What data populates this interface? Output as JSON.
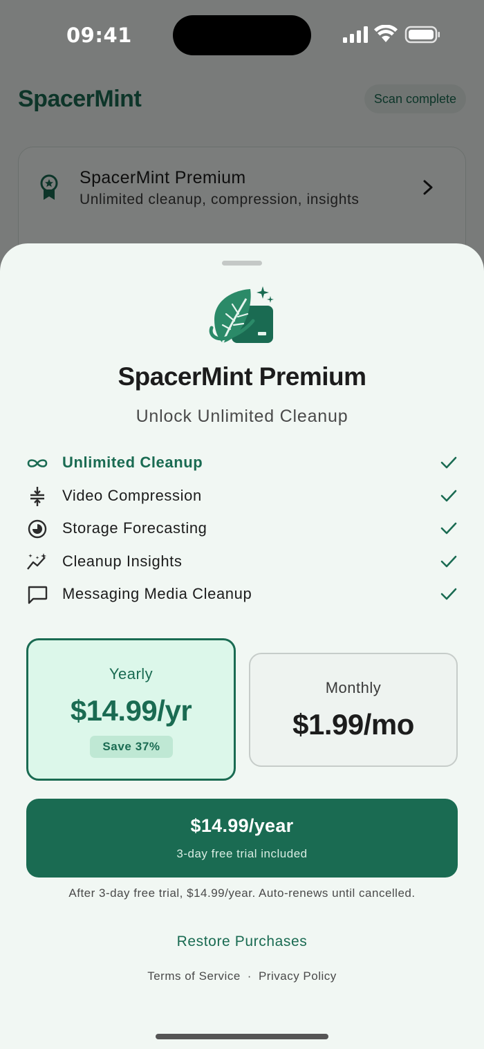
{
  "status_bar": {
    "time": "09:41"
  },
  "background": {
    "brand": "SpacerMint",
    "scan_status": "Scan complete",
    "premium_card": {
      "title": "SpacerMint Premium",
      "subtitle": "Unlimited cleanup, compression, insights"
    }
  },
  "paywall": {
    "title": "SpacerMint Premium",
    "subtitle": "Unlock Unlimited Cleanup",
    "features": [
      {
        "label": "Unlimited Cleanup",
        "icon": "infinity-icon",
        "highlighted": true
      },
      {
        "label": "Video Compression",
        "icon": "compress-icon",
        "highlighted": false
      },
      {
        "label": "Storage Forecasting",
        "icon": "forecast-icon",
        "highlighted": false
      },
      {
        "label": "Cleanup Insights",
        "icon": "insights-icon",
        "highlighted": false
      },
      {
        "label": "Messaging Media Cleanup",
        "icon": "message-icon",
        "highlighted": false
      }
    ],
    "plans": {
      "yearly": {
        "name": "Yearly",
        "price": "$14.99/yr",
        "badge": "Save 37%",
        "selected": true
      },
      "monthly": {
        "name": "Monthly",
        "price": "$1.99/mo",
        "selected": false
      }
    },
    "cta": {
      "label": "$14.99/year",
      "sublabel": "3-day free trial included"
    },
    "disclaimer": "After 3-day free trial, $14.99/year. Auto-renews until cancelled.",
    "restore": "Restore Purchases",
    "terms": "Terms of Service",
    "separator": "·",
    "privacy": "Privacy Policy"
  },
  "colors": {
    "accent": "#1a6b52",
    "selected_plan_bg": "#dcf7ea",
    "sheet_bg": "#f1f7f3"
  }
}
